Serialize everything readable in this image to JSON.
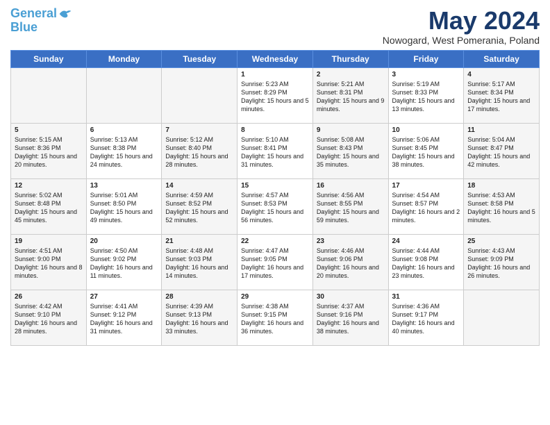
{
  "header": {
    "logo_line1": "General",
    "logo_line2": "Blue",
    "title": "May 2024",
    "subtitle": "Nowogard, West Pomerania, Poland"
  },
  "days_of_week": [
    "Sunday",
    "Monday",
    "Tuesday",
    "Wednesday",
    "Thursday",
    "Friday",
    "Saturday"
  ],
  "weeks": [
    [
      {
        "day": null,
        "class": "sun empty"
      },
      {
        "day": null,
        "class": "mon empty"
      },
      {
        "day": null,
        "class": "tue empty"
      },
      {
        "day": "1",
        "class": "wed",
        "sunrise": "5:23 AM",
        "sunset": "8:29 PM",
        "daylight": "15 hours and 5 minutes."
      },
      {
        "day": "2",
        "class": "thu",
        "sunrise": "5:21 AM",
        "sunset": "8:31 PM",
        "daylight": "15 hours and 9 minutes."
      },
      {
        "day": "3",
        "class": "fri",
        "sunrise": "5:19 AM",
        "sunset": "8:33 PM",
        "daylight": "15 hours and 13 minutes."
      },
      {
        "day": "4",
        "class": "sat",
        "sunrise": "5:17 AM",
        "sunset": "8:34 PM",
        "daylight": "15 hours and 17 minutes."
      }
    ],
    [
      {
        "day": "5",
        "class": "sun",
        "sunrise": "5:15 AM",
        "sunset": "8:36 PM",
        "daylight": "15 hours and 20 minutes."
      },
      {
        "day": "6",
        "class": "mon",
        "sunrise": "5:13 AM",
        "sunset": "8:38 PM",
        "daylight": "15 hours and 24 minutes."
      },
      {
        "day": "7",
        "class": "tue",
        "sunrise": "5:12 AM",
        "sunset": "8:40 PM",
        "daylight": "15 hours and 28 minutes."
      },
      {
        "day": "8",
        "class": "wed",
        "sunrise": "5:10 AM",
        "sunset": "8:41 PM",
        "daylight": "15 hours and 31 minutes."
      },
      {
        "day": "9",
        "class": "thu",
        "sunrise": "5:08 AM",
        "sunset": "8:43 PM",
        "daylight": "15 hours and 35 minutes."
      },
      {
        "day": "10",
        "class": "fri",
        "sunrise": "5:06 AM",
        "sunset": "8:45 PM",
        "daylight": "15 hours and 38 minutes."
      },
      {
        "day": "11",
        "class": "sat",
        "sunrise": "5:04 AM",
        "sunset": "8:47 PM",
        "daylight": "15 hours and 42 minutes."
      }
    ],
    [
      {
        "day": "12",
        "class": "sun",
        "sunrise": "5:02 AM",
        "sunset": "8:48 PM",
        "daylight": "15 hours and 45 minutes."
      },
      {
        "day": "13",
        "class": "mon",
        "sunrise": "5:01 AM",
        "sunset": "8:50 PM",
        "daylight": "15 hours and 49 minutes."
      },
      {
        "day": "14",
        "class": "tue",
        "sunrise": "4:59 AM",
        "sunset": "8:52 PM",
        "daylight": "15 hours and 52 minutes."
      },
      {
        "day": "15",
        "class": "wed",
        "sunrise": "4:57 AM",
        "sunset": "8:53 PM",
        "daylight": "15 hours and 56 minutes."
      },
      {
        "day": "16",
        "class": "thu",
        "sunrise": "4:56 AM",
        "sunset": "8:55 PM",
        "daylight": "15 hours and 59 minutes."
      },
      {
        "day": "17",
        "class": "fri",
        "sunrise": "4:54 AM",
        "sunset": "8:57 PM",
        "daylight": "16 hours and 2 minutes."
      },
      {
        "day": "18",
        "class": "sat",
        "sunrise": "4:53 AM",
        "sunset": "8:58 PM",
        "daylight": "16 hours and 5 minutes."
      }
    ],
    [
      {
        "day": "19",
        "class": "sun",
        "sunrise": "4:51 AM",
        "sunset": "9:00 PM",
        "daylight": "16 hours and 8 minutes."
      },
      {
        "day": "20",
        "class": "mon",
        "sunrise": "4:50 AM",
        "sunset": "9:02 PM",
        "daylight": "16 hours and 11 minutes."
      },
      {
        "day": "21",
        "class": "tue",
        "sunrise": "4:48 AM",
        "sunset": "9:03 PM",
        "daylight": "16 hours and 14 minutes."
      },
      {
        "day": "22",
        "class": "wed",
        "sunrise": "4:47 AM",
        "sunset": "9:05 PM",
        "daylight": "16 hours and 17 minutes."
      },
      {
        "day": "23",
        "class": "thu",
        "sunrise": "4:46 AM",
        "sunset": "9:06 PM",
        "daylight": "16 hours and 20 minutes."
      },
      {
        "day": "24",
        "class": "fri",
        "sunrise": "4:44 AM",
        "sunset": "9:08 PM",
        "daylight": "16 hours and 23 minutes."
      },
      {
        "day": "25",
        "class": "sat",
        "sunrise": "4:43 AM",
        "sunset": "9:09 PM",
        "daylight": "16 hours and 26 minutes."
      }
    ],
    [
      {
        "day": "26",
        "class": "sun",
        "sunrise": "4:42 AM",
        "sunset": "9:10 PM",
        "daylight": "16 hours and 28 minutes."
      },
      {
        "day": "27",
        "class": "mon",
        "sunrise": "4:41 AM",
        "sunset": "9:12 PM",
        "daylight": "16 hours and 31 minutes."
      },
      {
        "day": "28",
        "class": "tue",
        "sunrise": "4:39 AM",
        "sunset": "9:13 PM",
        "daylight": "16 hours and 33 minutes."
      },
      {
        "day": "29",
        "class": "wed",
        "sunrise": "4:38 AM",
        "sunset": "9:15 PM",
        "daylight": "16 hours and 36 minutes."
      },
      {
        "day": "30",
        "class": "thu",
        "sunrise": "4:37 AM",
        "sunset": "9:16 PM",
        "daylight": "16 hours and 38 minutes."
      },
      {
        "day": "31",
        "class": "fri",
        "sunrise": "4:36 AM",
        "sunset": "9:17 PM",
        "daylight": "16 hours and 40 minutes."
      },
      {
        "day": null,
        "class": "sat empty"
      }
    ]
  ],
  "labels": {
    "sunrise_label": "Sunrise:",
    "sunset_label": "Sunset:",
    "daylight_label": "Daylight:"
  }
}
